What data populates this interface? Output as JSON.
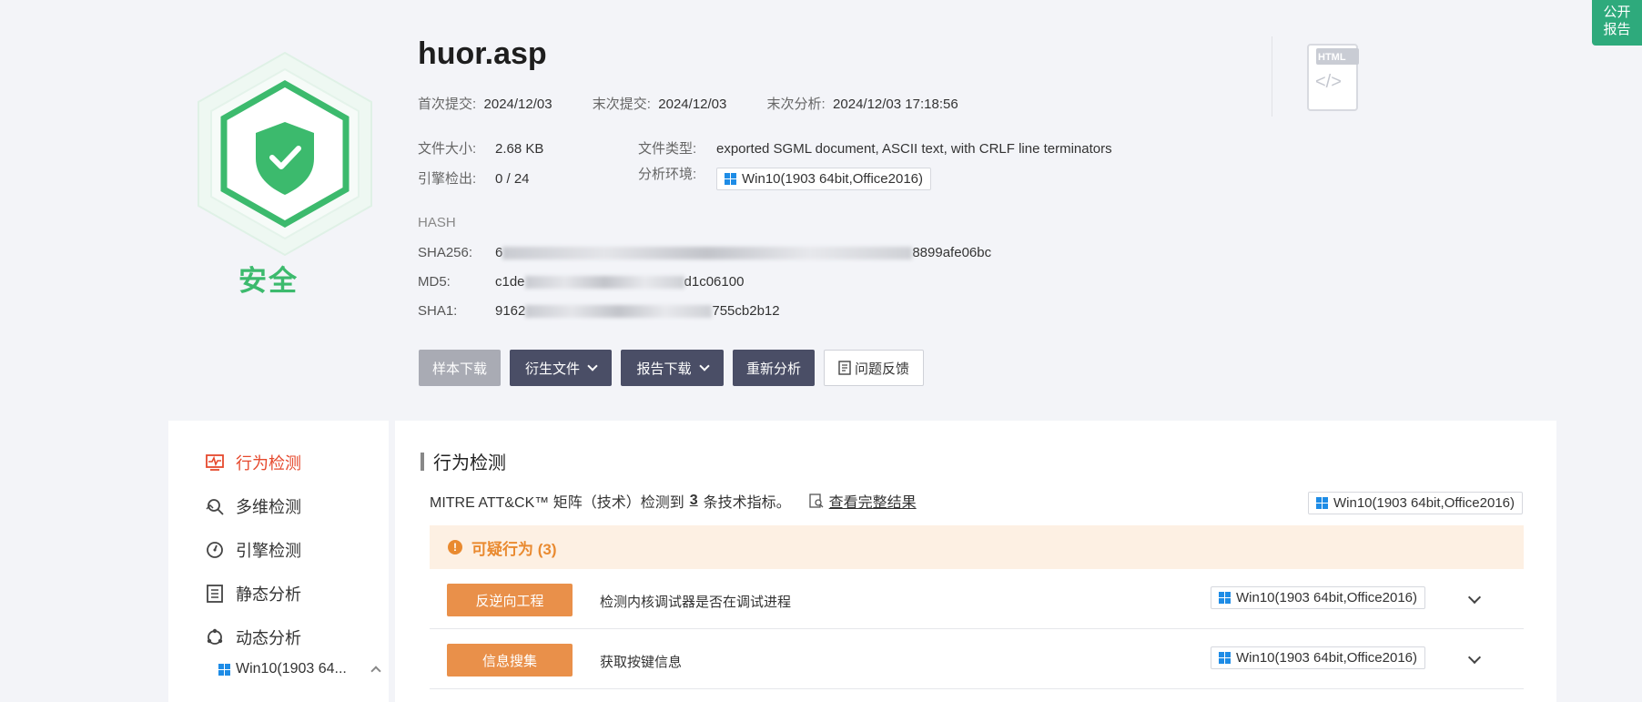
{
  "public_report": [
    "公开",
    "报告"
  ],
  "verdict": "安全",
  "file": {
    "name": "huor.asp",
    "first_submit_label": "首次提交:",
    "first_submit": "2024/12/03",
    "last_submit_label": "末次提交:",
    "last_submit": "2024/12/03",
    "last_analysis_label": "末次分析:",
    "last_analysis": "2024/12/03 17:18:56",
    "size_label": "文件大小:",
    "size": "2.68 KB",
    "type_label": "文件类型:",
    "type": "exported SGML document, ASCII text, with CRLF line terminators",
    "engine_label": "引擎检出:",
    "engine": "0 / 24",
    "env_label": "分析环境:",
    "env": "Win10(1903 64bit,Office2016)"
  },
  "hash": {
    "title": "HASH",
    "sha256_label": "SHA256:",
    "sha256_head": "6",
    "sha256_tail": "8899afe06bc",
    "md5_label": "MD5:",
    "md5_head": "c1de",
    "md5_tail": "d1c06100",
    "sha1_label": "SHA1:",
    "sha1_head": "9162",
    "sha1_tail": "755cb2b12"
  },
  "buttons": {
    "sample_download": "样本下载",
    "derived_files": "衍生文件",
    "report_download": "报告下载",
    "reanalyze": "重新分析",
    "feedback": "问题反馈"
  },
  "html_badge": "HTML",
  "nav": {
    "behavior": "行为检测",
    "multi": "多维检测",
    "engine": "引擎检测",
    "static": "静态分析",
    "dynamic": "动态分析",
    "sub_env": "Win10(1903 64..."
  },
  "main": {
    "section_title": "行为检测",
    "mitre_prefix": "MITRE ATT&CK™ 矩阵（技术）检测到",
    "mitre_count": "3",
    "mitre_suffix": "条技术指标。",
    "view_full": "查看完整结果",
    "env": "Win10(1903 64bit,Office2016)",
    "suspicious_label": "可疑行为 (3)",
    "rows": [
      {
        "tag": "反逆向工程",
        "desc": "检测内核调试器是否在调试进程",
        "env": "Win10(1903 64bit,Office2016)"
      },
      {
        "tag": "信息搜集",
        "desc": "获取按键信息",
        "env": "Win10(1903 64bit,Office2016)"
      }
    ]
  },
  "colors": {
    "safe_green": "#3cba6d",
    "accent_orange": "#e9904a",
    "active_red": "#e6492d",
    "dark_button": "#4a4e66"
  }
}
